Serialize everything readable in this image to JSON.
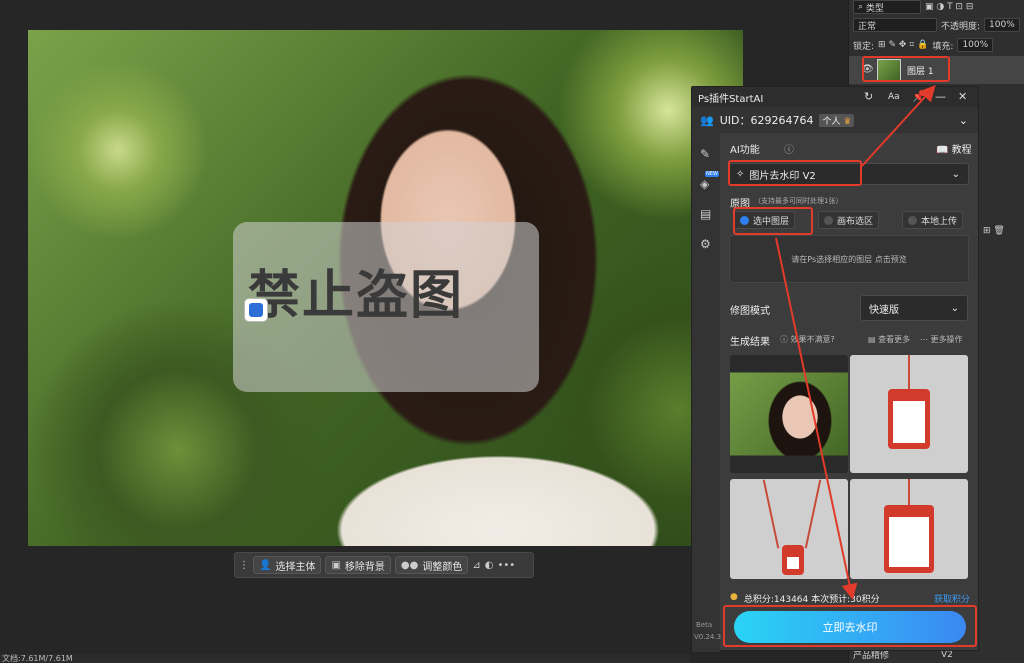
{
  "canvas": {
    "watermark_text": "禁止盗图"
  },
  "toolbar": {
    "select_subject": "选择主体",
    "remove_bg": "移除背景",
    "adjust_color": "调整颜色"
  },
  "statusbar": {
    "text": "文档:7.61M/7.61M"
  },
  "layers": {
    "kind_label": "类型",
    "blend_mode": "正常",
    "opacity_label": "不透明度:",
    "opacity_value": "100%",
    "lock_label": "锁定:",
    "fill_label": "填充:",
    "fill_value": "100%",
    "layer_name": "图层 1",
    "bottom_item": "产品精修",
    "bottom_version": "V2"
  },
  "plugin": {
    "title": "Ps插件StartAI",
    "uid_label": "UID：",
    "uid_value": "629264764",
    "account_type": "个人",
    "ai_function_label": "AI功能",
    "tutorial_label": "教程",
    "function_selected": "图片去水印 V2",
    "source_label": "原图",
    "source_hint": "（支持最多可同时处理1张）",
    "opt_selected_layer": "选中图层",
    "opt_canvas_selection": "画布选区",
    "opt_local_upload": "本地上传",
    "preview_hint": "请在Ps选择相应的图层 点击预览",
    "retouch_mode_label": "修图模式",
    "retouch_mode_value": "快速版",
    "results_label": "生成结果",
    "results_unsatisfied": "效果不满意?",
    "view_more": "查看更多",
    "more_actions": "更多操作",
    "total_points": "总积分:143464  本次预计:30积分",
    "get_points": "获取积分",
    "cta_label": "立即去水印",
    "beta_label": "Beta",
    "version": "V0.24.3"
  }
}
